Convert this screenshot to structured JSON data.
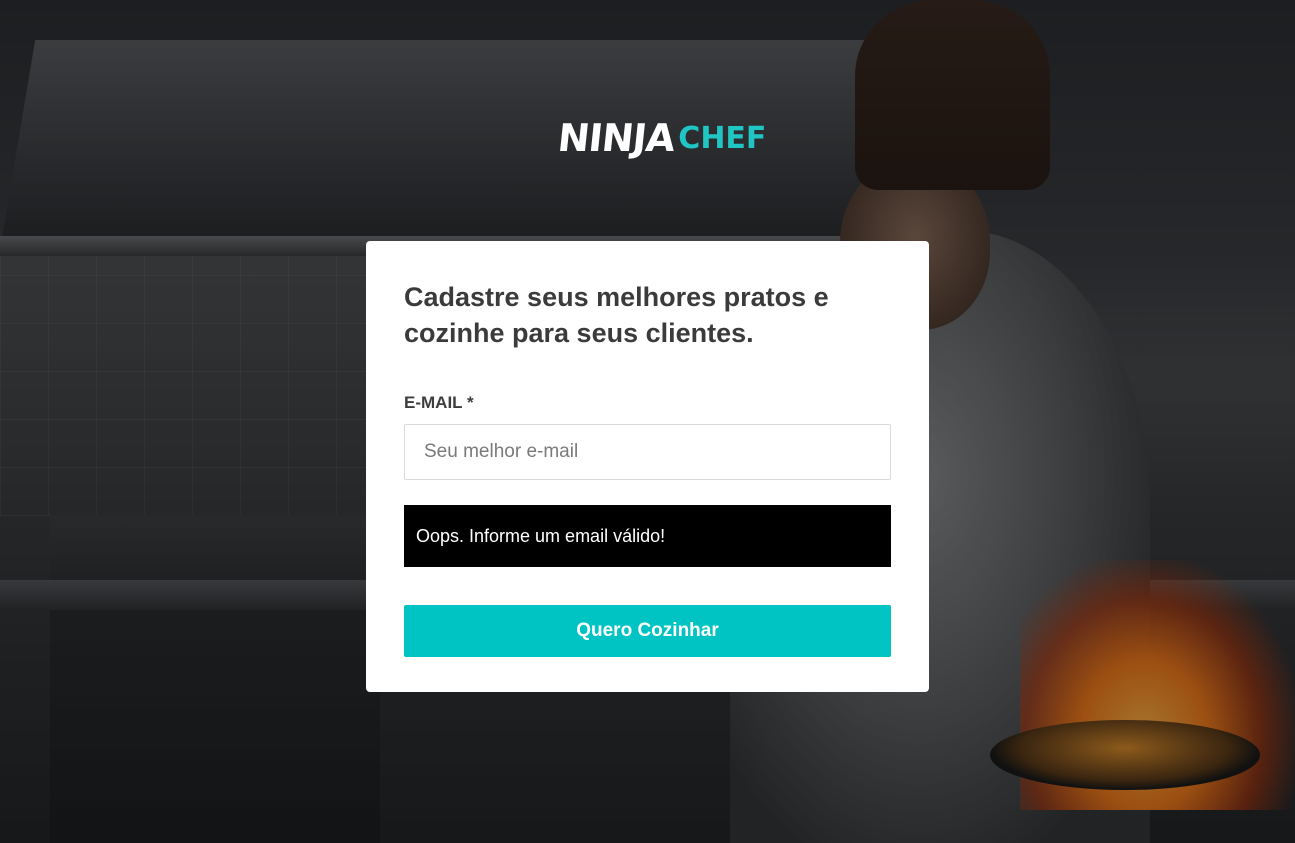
{
  "logo": {
    "part1": "NINJA",
    "part2": "CHEF",
    "accent_color": "#1fc6c3"
  },
  "form": {
    "heading": "Cadastre seus melhores pratos e cozinhe para seus clientes.",
    "email_label": "E-MAIL *",
    "email_placeholder": "Seu melhor e-mail",
    "email_value": "",
    "error_message": "Oops. Informe um email válido!",
    "submit_label": "Quero Cozinhar",
    "button_color": "#00c4c3"
  }
}
